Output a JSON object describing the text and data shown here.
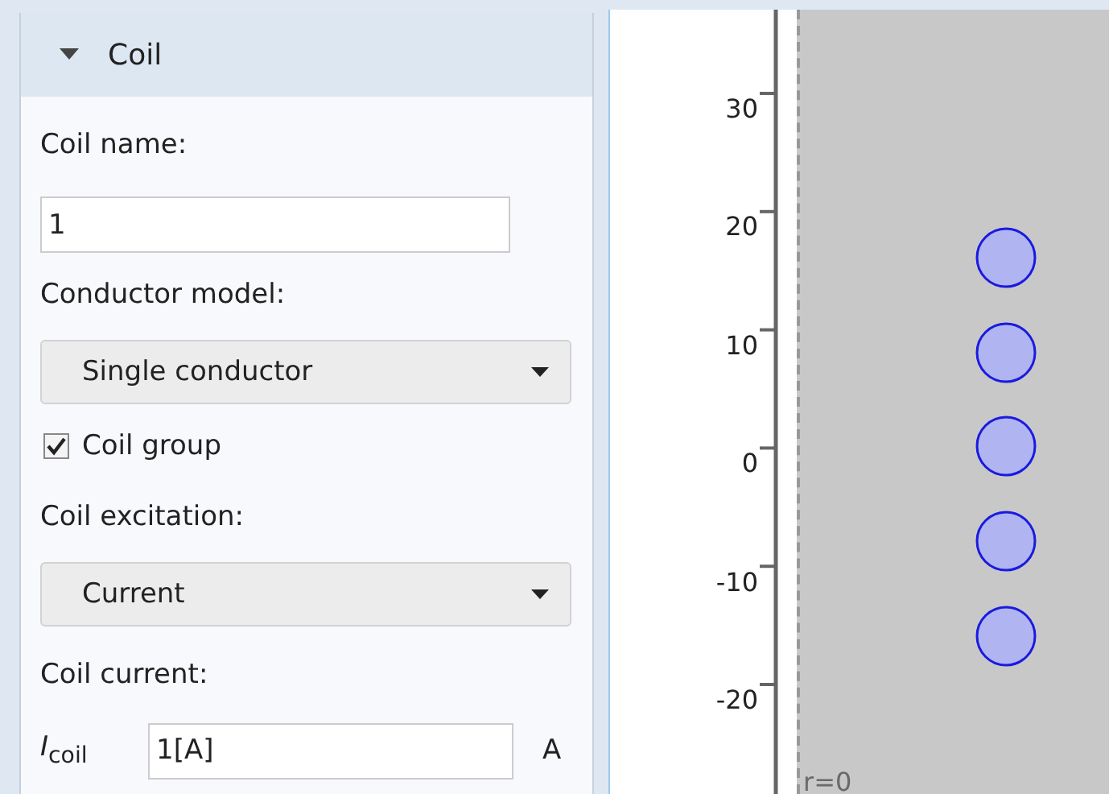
{
  "section": {
    "title": "Coil",
    "expanded": true
  },
  "fields": [
    {
      "kind": "text",
      "label": "Coil name:",
      "value": "1"
    },
    {
      "kind": "select",
      "label": "Conductor model:",
      "value": "Single conductor"
    },
    {
      "kind": "checkbox",
      "label": "Coil group",
      "checked": true
    },
    {
      "kind": "select",
      "label": "Coil excitation:",
      "value": "Current"
    },
    {
      "kind": "quantity",
      "label": "Coil current:",
      "symbol": "*I*$_{coil}$",
      "value": "1[A]",
      "unit": "A"
    }
  ],
  "graphics": {
    "y_ticks": [
      "30",
      "20",
      "10",
      "0",
      "-10",
      "-20"
    ],
    "axis_label": "r=0"
  }
}
